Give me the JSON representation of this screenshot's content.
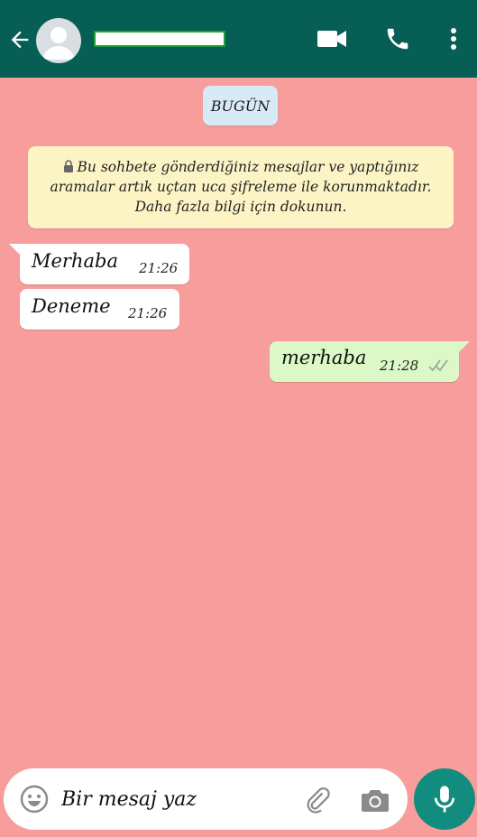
{
  "colors": {
    "header": "#075e54",
    "chat_background": "#f79e9c",
    "incoming_bubble": "#ffffff",
    "outgoing_bubble": "#dcf8c6",
    "notice_background": "#fdf4c5",
    "date_chip_background": "#d8eaf5",
    "mic_button": "#128c7e",
    "read_ticks": "#9aa6a0"
  },
  "header": {
    "icons": [
      "arrow-back-icon",
      "avatar",
      "video-call-icon",
      "phone-icon",
      "more-vert-icon"
    ]
  },
  "chat": {
    "date_chip": "BUGÜN",
    "encryption_notice": "Bu sohbete gönderdiğiniz mesajlar ve yaptığınız aramalar artık uçtan uca şifreleme ile korunmaktadır. Daha fazla bilgi için dokunun.",
    "messages": [
      {
        "direction": "incoming",
        "text": "Merhaba",
        "time": "21:26"
      },
      {
        "direction": "incoming",
        "text": "Deneme",
        "time": "21:26"
      },
      {
        "direction": "outgoing",
        "text": "merhaba",
        "time": "21:28",
        "status": "double-tick"
      }
    ]
  },
  "composer": {
    "placeholder": "Bir mesaj yaz",
    "icons": [
      "emoji-icon",
      "attachment-icon",
      "camera-icon",
      "microphone-icon"
    ]
  }
}
